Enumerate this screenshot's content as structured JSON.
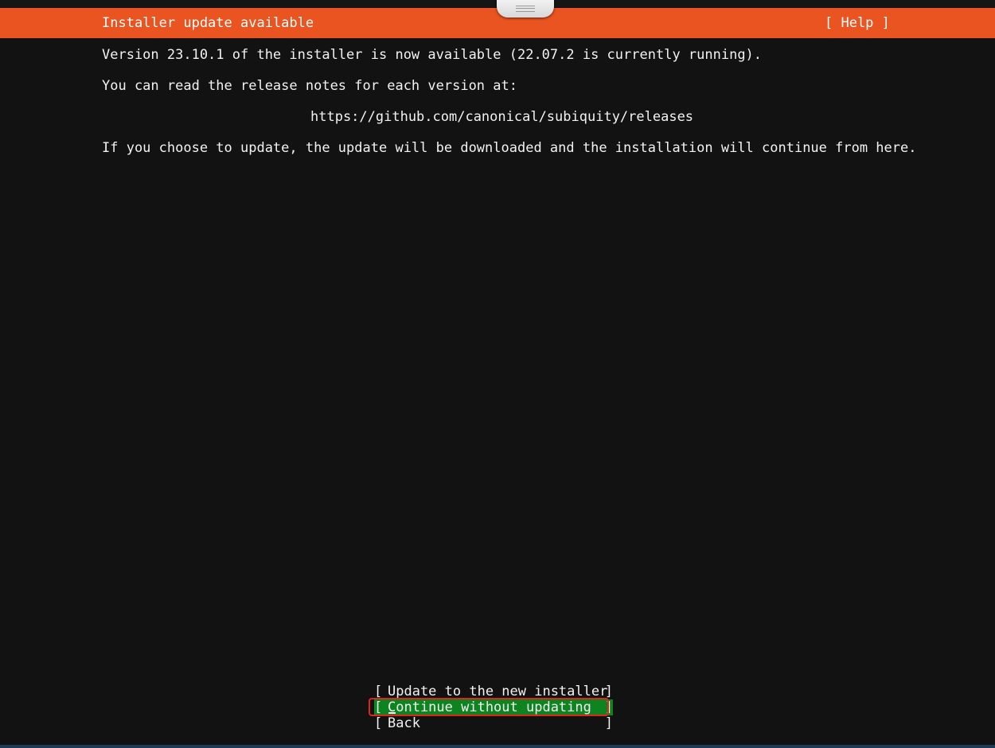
{
  "header": {
    "title": "Installer update available",
    "help_label": "[ Help ]"
  },
  "body": {
    "version_line": "Version 23.10.1 of the installer is now available (22.07.2 is currently running).",
    "notes_line": "You can read the release notes for each version at:",
    "url": "https://github.com/canonical/subiquity/releases",
    "continue_line": "If you choose to update, the update will be downloaded and the installation will continue from here."
  },
  "buttons": {
    "open_bracket": "[",
    "close_bracket": "]",
    "update_label": "Update to the new installer",
    "continue_label": "Continue without updating",
    "back_label": "Back"
  },
  "colors": {
    "header": "#e95420",
    "selected_button": "#0e8420",
    "background": "#121212",
    "focus_ring": "#e0251f"
  }
}
